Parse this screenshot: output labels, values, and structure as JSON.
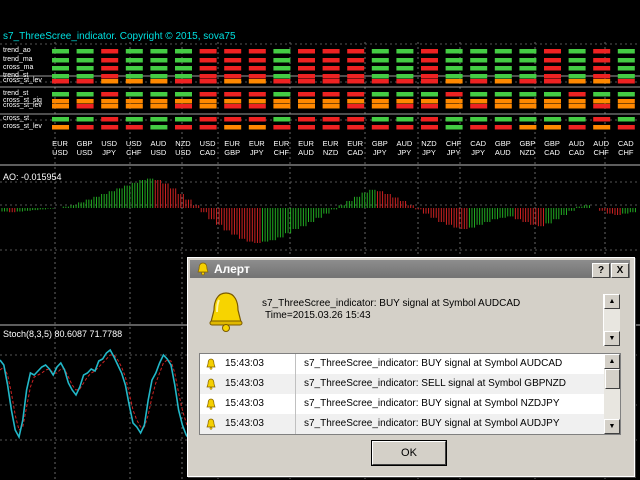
{
  "indicator_title": "s7_ThreeScree_indicator. Copyright © 2015, sova75",
  "row_labels": [
    "trend_ao",
    "trend_ma",
    "cross_ma",
    "trend_st",
    "cross_st_lev",
    "trend_st",
    "cross_st_sig",
    "cross_st_lev",
    "cross_st",
    "cross_st_lev"
  ],
  "pairs": [
    {
      "top": "EUR",
      "bot": "USD"
    },
    {
      "top": "GBP",
      "bot": "USD"
    },
    {
      "top": "USD",
      "bot": "JPY"
    },
    {
      "top": "USD",
      "bot": "CHF"
    },
    {
      "top": "AUD",
      "bot": "USD"
    },
    {
      "top": "NZD",
      "bot": "USD"
    },
    {
      "top": "USD",
      "bot": "CAD"
    },
    {
      "top": "EUR",
      "bot": "GBP"
    },
    {
      "top": "EUR",
      "bot": "JPY"
    },
    {
      "top": "EUR",
      "bot": "CHF"
    },
    {
      "top": "EUR",
      "bot": "AUD"
    },
    {
      "top": "EUR",
      "bot": "NZD"
    },
    {
      "top": "EUR",
      "bot": "CAD"
    },
    {
      "top": "GBP",
      "bot": "JPY"
    },
    {
      "top": "AUD",
      "bot": "JPY"
    },
    {
      "top": "NZD",
      "bot": "JPY"
    },
    {
      "top": "CHF",
      "bot": "JPY"
    },
    {
      "top": "CAD",
      "bot": "JPY"
    },
    {
      "top": "GBP",
      "bot": "AUD"
    },
    {
      "top": "GBP",
      "bot": "NZD"
    },
    {
      "top": "GBP",
      "bot": "CAD"
    },
    {
      "top": "AUD",
      "bot": "CAD"
    },
    {
      "top": "AUD",
      "bot": "CHF"
    },
    {
      "top": "CAD",
      "bot": "CHF"
    }
  ],
  "grid": [
    "GGRGGGRRRGRRRGGRGGGGRGRG",
    "GGRGGGRRRGRRRGGRGGGGRGRG",
    "GGRGGGRRRGRRRGGRGGGGRGRG",
    "GGRGGGRRRGRRRGGRGGGGRGRG",
    "RROOORROORRRRRRRORORROOR",
    "GGRGGGRRRGRRRGGGRGGGGRGG",
    "OOOOOOOOOOOOOOOOOOOOOOOO",
    "OROOORORROOORORROROOOORO",
    "GGRGGGRRRGRRRGGRGGGGGGRG",
    "ORRRGRROORRRRRRRGRROOROR"
  ],
  "colors": {
    "green": "#44cc44",
    "red": "#ee2222",
    "orange": "#ff8800",
    "ao_up": "#22aa22",
    "ao_down": "#cc2222",
    "stoch_main": "#22b8c8",
    "stoch_signal": "#cc2222"
  },
  "ao_label": "AO: -0.015954",
  "ao_values": [
    -0.5,
    -0.6,
    -0.5,
    -0.4,
    -0.3,
    -0.2,
    -0.1,
    0,
    0.2,
    0.4,
    0.8,
    1.2,
    1.6,
    2.0,
    2.4,
    2.8,
    3.2,
    3.6,
    4.0,
    4.2,
    4.0,
    3.5,
    2.8,
    2.0,
    1.2,
    0.4,
    -0.6,
    -1.6,
    -2.4,
    -3.2,
    -3.8,
    -4.4,
    -4.8,
    -5.0,
    -4.8,
    -4.6,
    -4.2,
    -3.6,
    -3.0,
    -2.6,
    -2.0,
    -1.4,
    -0.8,
    -0.2,
    0.4,
    1.0,
    1.6,
    2.2,
    2.6,
    2.4,
    2.0,
    1.5,
    1.0,
    0.4,
    -0.2,
    -0.8,
    -1.4,
    -2.0,
    -2.4,
    -2.8,
    -3.0,
    -2.8,
    -2.4,
    -2.0,
    -1.6,
    -1.4,
    -1.2,
    -1.6,
    -2.0,
    -2.4,
    -2.6,
    -2.2,
    -1.6,
    -1.0,
    -0.4,
    0.2,
    0.4,
    0.0,
    -0.4,
    -0.8,
    -1.0,
    -0.8,
    -0.6
  ],
  "stoch_label": "Stoch(8,3,5) 80.6087 71.7788",
  "stoch_main": [
    85,
    80,
    60,
    35,
    15,
    8,
    25,
    55,
    72,
    70,
    74,
    78,
    80,
    76,
    70,
    78,
    82,
    75,
    62,
    55,
    50,
    58,
    70,
    72,
    76,
    74,
    84,
    86,
    92,
    95,
    88,
    80,
    72,
    60,
    40,
    22,
    18,
    12,
    20,
    45,
    65,
    72,
    82,
    90,
    86,
    80,
    60,
    35,
    20,
    10,
    5
  ],
  "stoch_signal": [
    75,
    78,
    70,
    52,
    30,
    15,
    18,
    38,
    58,
    68,
    70,
    72,
    75,
    76,
    72,
    72,
    76,
    76,
    68,
    60,
    55,
    56,
    62,
    68,
    72,
    74,
    78,
    82,
    86,
    90,
    90,
    85,
    78,
    68,
    52,
    35,
    25,
    18,
    18,
    30,
    48,
    62,
    72,
    82,
    85,
    84,
    72,
    52,
    35,
    22,
    12
  ],
  "dialog": {
    "title": "Алерт",
    "help_btn": "?",
    "close_btn": "X",
    "message_line1": "s7_ThreeScree_indicator: BUY signal at Symbol AUDCAD",
    "message_line2": "Time=2015.03.26 15:43",
    "alerts": [
      {
        "time": "15:43:03",
        "text": "s7_ThreeScree_indicator: BUY signal at Symbol AUDCAD"
      },
      {
        "time": "15:43:03",
        "text": "s7_ThreeScree_indicator: SELL signal at Symbol GBPNZD"
      },
      {
        "time": "15:43:03",
        "text": "s7_ThreeScree_indicator: BUY signal at Symbol NZDJPY"
      },
      {
        "time": "15:43:03",
        "text": "s7_ThreeScree_indicator: BUY signal at Symbol AUDJPY"
      }
    ],
    "ok_label": "OK"
  }
}
